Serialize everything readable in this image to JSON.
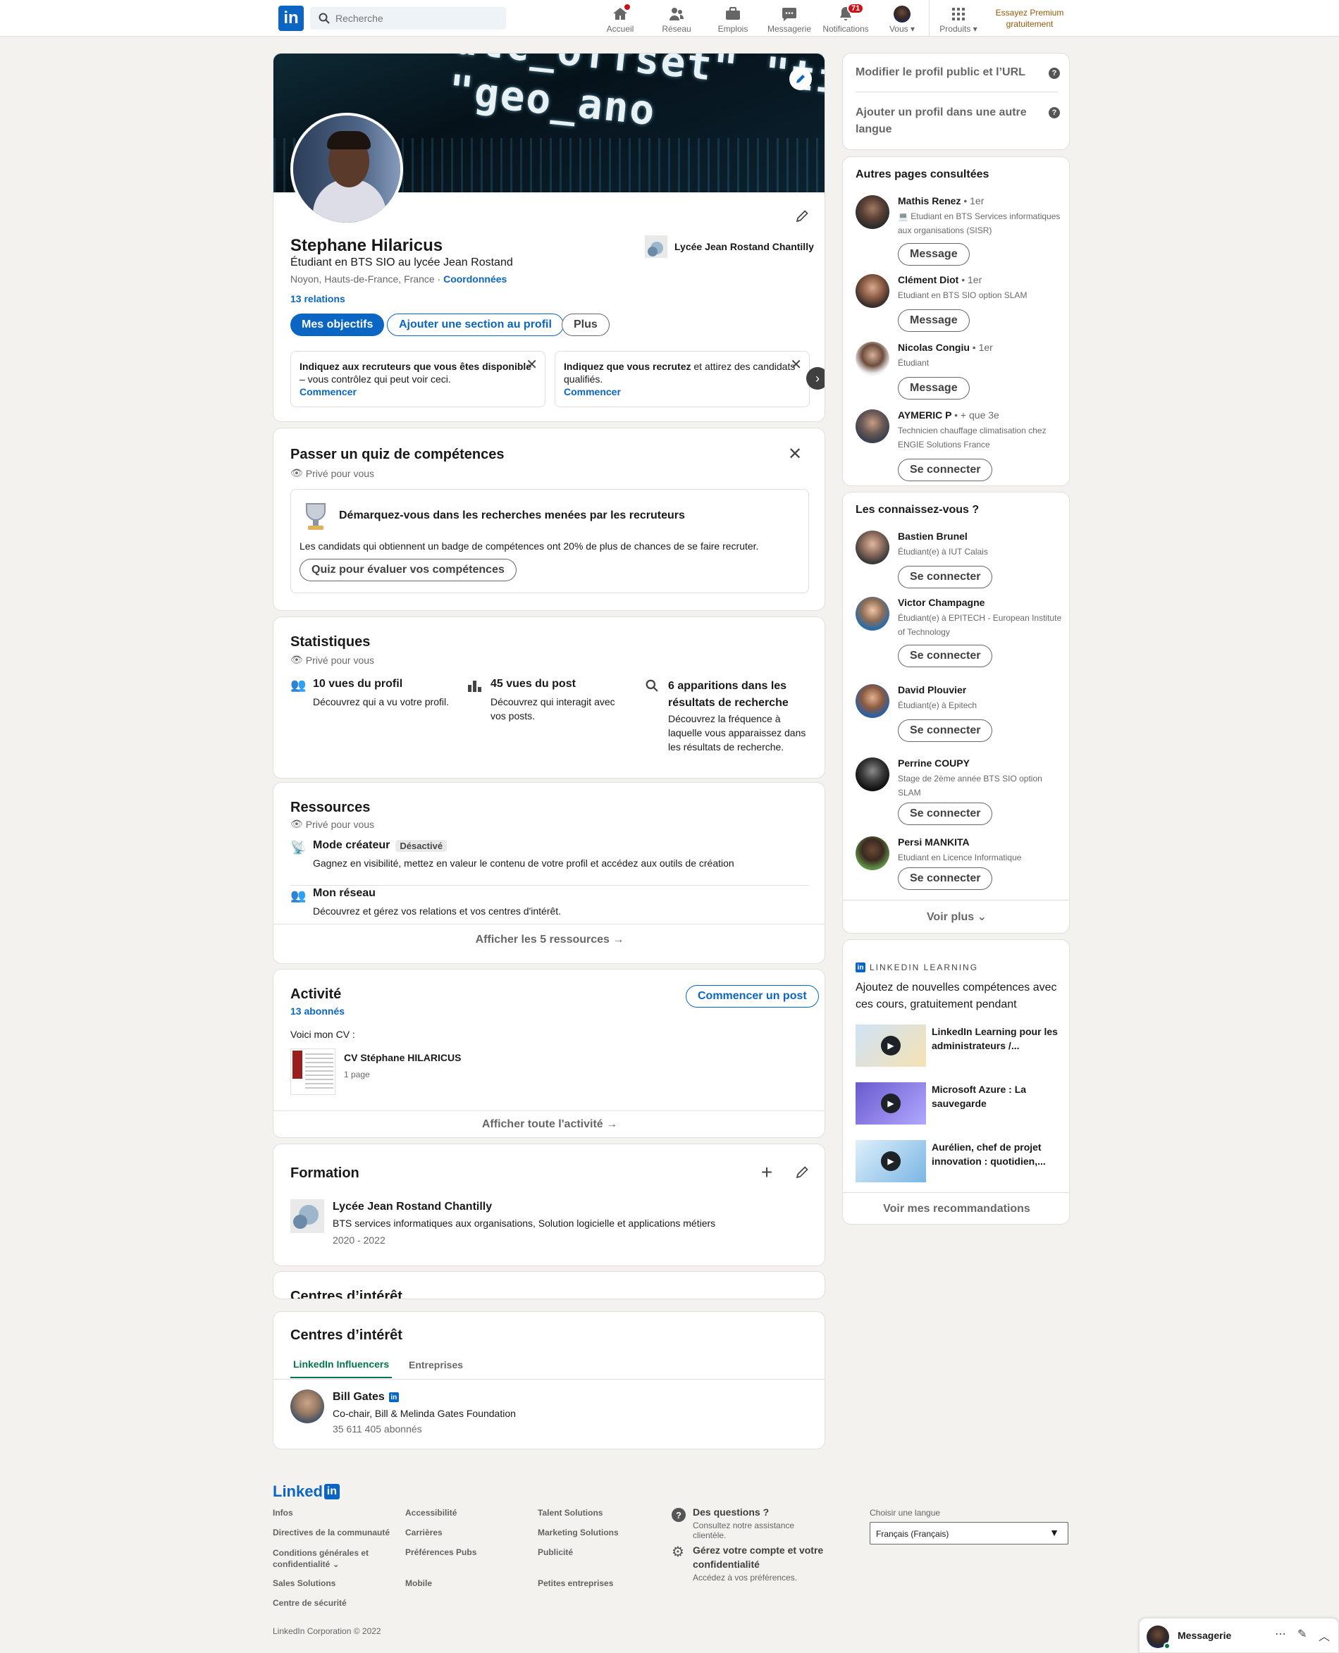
{
  "header": {
    "search_placeholder": "Recherche",
    "nav": [
      {
        "label": "Accueil"
      },
      {
        "label": "Réseau"
      },
      {
        "label": "Emplois"
      },
      {
        "label": "Messagerie"
      },
      {
        "label": "Notifications",
        "badge": "71"
      },
      {
        "label": "Vous"
      },
      {
        "label": "Produits"
      }
    ],
    "premium_line1": "Essayez Premium",
    "premium_line2": "gratuitement"
  },
  "profile": {
    "name": "Stephane Hilaricus",
    "headline": "Étudiant en BTS SIO au lycée Jean Rostand",
    "location": "Noyon, Hauts-de-France, France",
    "contact_link": "Coordonnées",
    "connections": "13 relations",
    "school": "Lycée Jean Rostand Chantilly",
    "btn_objectives": "Mes objectifs",
    "btn_add_section": "Ajouter une section au profil",
    "btn_more": "Plus",
    "banner_text": "dtc_offset\" \"time_zone\" \"geo_ano",
    "suggestions": [
      {
        "text_bold": "Indiquez aux recruteurs que vous êtes disponible",
        "text_rest": " – vous contrôlez qui peut voir ceci.",
        "link": "Commencer"
      },
      {
        "text_pre": "Indiquez que ",
        "text_bold": "vous recrutez",
        "text_rest": " et attirez des candidats qualifiés.",
        "link": "Commencer"
      }
    ]
  },
  "quiz": {
    "title": "Passer un quiz de compétences",
    "private": "Privé pour vous",
    "headline": "Démarquez-vous dans les recherches menées par les recruteurs",
    "body": "Les candidats qui obtiennent un badge de compétences ont 20% de plus de chances de se faire recruter.",
    "button": "Quiz pour évaluer vos compétences"
  },
  "stats": {
    "title": "Statistiques",
    "private": "Privé pour vous",
    "items": [
      {
        "title": "10 vues du profil",
        "desc": "Découvrez qui a vu votre profil."
      },
      {
        "title": "45 vues du post",
        "desc": "Découvrez qui interagit avec vos posts."
      },
      {
        "title": "6 apparitions dans les résultats de recherche",
        "desc": "Découvrez la fréquence à laquelle vous apparaissez dans les résultats de recherche."
      }
    ]
  },
  "resources": {
    "title": "Ressources",
    "private": "Privé pour vous",
    "items": [
      {
        "title": "Mode créateur",
        "badge": "Désactivé",
        "desc": "Gagnez en visibilité, mettez en valeur le contenu de votre profil et accédez aux outils de création"
      },
      {
        "title": "Mon réseau",
        "desc": "Découvrez et gérez vos relations et vos centres d'intérêt."
      }
    ],
    "show_all": "Afficher les 5 ressources →"
  },
  "activity": {
    "title": "Activité",
    "followers": "13 abonnés",
    "start_post": "Commencer un post",
    "post_text": "Voici mon CV :",
    "doc_title": "CV Stéphane HILARICUS",
    "doc_pages": "1 page",
    "show_all": "Afficher toute l'activité →"
  },
  "education": {
    "title": "Formation",
    "school": "Lycée Jean Rostand Chantilly",
    "degree": "BTS services informatiques aux organisations, Solution logicielle et applications métiers",
    "dates": "2020 - 2022"
  },
  "interests": {
    "title_ghost": "Centres d’intérêt",
    "title": "Centres d’intérêt",
    "tabs": [
      "LinkedIn Influencers",
      "Entreprises"
    ],
    "person": {
      "name": "Bill Gates",
      "title": "Co-chair, Bill & Melinda Gates Foundation",
      "followers": "35 611 405 abonnés"
    }
  },
  "sidebar": {
    "edit_public": "Modifier le profil public et l’URL",
    "add_language": "Ajouter un profil dans une autre langue",
    "viewed_title": "Autres pages consultées",
    "viewed": [
      {
        "name": "Mathis Renez",
        "degree": "• 1er",
        "title": "💻 Etudiant en BTS Services informatiques aux organisations (SISR)",
        "button": "Message"
      },
      {
        "name": "Clément Diot",
        "degree": "• 1er",
        "title": "Etudiant en BTS SIO option SLAM",
        "button": "Message"
      },
      {
        "name": "Nicolas Congiu",
        "degree": "• 1er",
        "title": "Étudiant",
        "button": "Message"
      },
      {
        "name": "AYMERIC P",
        "degree": "• + que 3e",
        "title": "Technicien chauffage climatisation chez ENGIE Solutions France",
        "button": "Se connecter"
      }
    ],
    "pymk_title": "Les connaissez-vous ?",
    "pymk": [
      {
        "name": "Bastien Brunel",
        "title": "Étudiant(e) à IUT Calais",
        "button": "Se connecter"
      },
      {
        "name": "Victor Champagne",
        "title": "Étudiant(e) à EPITECH - European Institute of Technology",
        "button": "Se connecter"
      },
      {
        "name": "David Plouvier",
        "title": "Étudiant(e) à Epitech",
        "button": "Se connecter"
      },
      {
        "name": "Perrine COUPY",
        "title": "Stage de 2ème année BTS SIO option SLAM",
        "button": "Se connecter"
      },
      {
        "name": "Persi MANKITA",
        "title": "Etudiant en Licence Informatique",
        "button": "Se connecter"
      }
    ],
    "see_more": "Voir plus",
    "learning_label": "LINKEDIN LEARNING",
    "learning_title": "Ajoutez de nouvelles compétences avec ces cours, gratuitement pendant",
    "courses": [
      {
        "title": "LinkedIn Learning pour les administrateurs /..."
      },
      {
        "title": "Microsoft Azure : La sauvegarde"
      },
      {
        "title": "Aurélien, chef de projet innovation : quotidien,..."
      }
    ],
    "recommendations": "Voir mes recommandations"
  },
  "footer": {
    "logo": "Linked",
    "col1": [
      "Infos",
      "Directives de la communauté",
      "Conditions générales et confidentialité ⌄",
      "Sales Solutions",
      "Centre de sécurité"
    ],
    "col2": [
      "Accessibilité",
      "Carrières",
      "Préférences Pubs",
      "Mobile"
    ],
    "col3": [
      "Talent Solutions",
      "Marketing Solutions",
      "Publicité",
      "Petites entreprises"
    ],
    "help_title": "Des questions ?",
    "help_sub": "Consultez notre assistance clientèle.",
    "account_title": "Gérez votre compte et votre confidentialité",
    "account_sub": "Accédez à vos préférences.",
    "lang_label": "Choisir une langue",
    "lang_value": "Français (Français)",
    "copyright": "LinkedIn Corporation © 2022"
  },
  "messaging": {
    "label": "Messagerie"
  }
}
